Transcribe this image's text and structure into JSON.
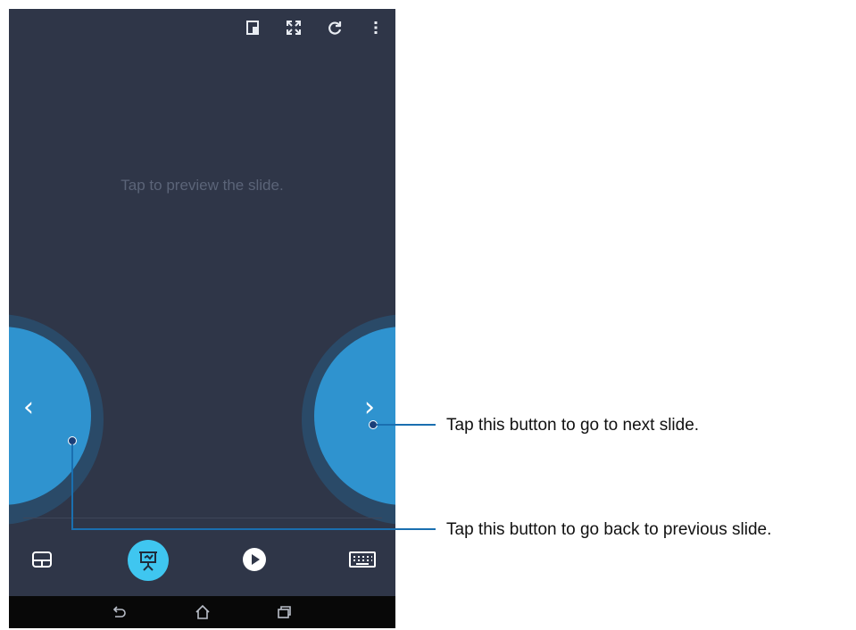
{
  "screen": {
    "preview_hint": "Tap to preview the slide."
  },
  "topbar": {
    "icons": [
      "presentation-view-icon",
      "fullscreen-icon",
      "refresh-icon",
      "more-vert-icon"
    ]
  },
  "nav_buttons": {
    "prev_glyph": "‹",
    "next_glyph": "›"
  },
  "bottombar": {
    "icons": [
      "touchpad-icon",
      "presenter-icon",
      "play-icon",
      "keyboard-icon"
    ],
    "active": "presenter-icon"
  },
  "system_nav": {
    "icons": [
      "back-icon",
      "home-icon",
      "recents-icon"
    ]
  },
  "callouts": {
    "next": "Tap this button to go to next slide.",
    "prev": "Tap this button to go back to previous slide."
  },
  "colors": {
    "screen_bg": "#2f3648",
    "accent": "#2f93cf",
    "active_icon_bg": "#3fc6f0",
    "callout_line": "#1a6fb0"
  }
}
